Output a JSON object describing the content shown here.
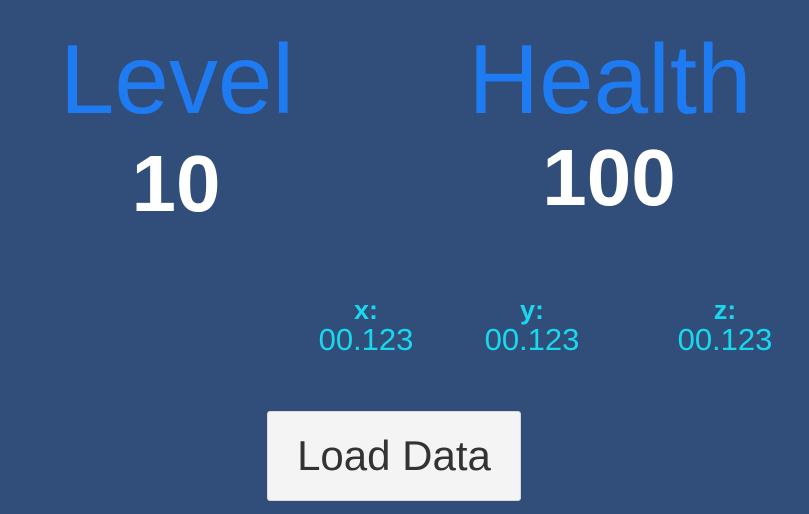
{
  "colors": {
    "background": "#314d7a",
    "stat_title": "#1e7bf2",
    "stat_value": "#ffffff",
    "coordinates": "#19d8ee",
    "button_background": "#f4f4f4",
    "button_text": "#333333"
  },
  "stats": {
    "level": {
      "title": "Level",
      "value": "10"
    },
    "health": {
      "title": "Health",
      "value": "100"
    }
  },
  "position": {
    "x": {
      "label": "x:",
      "value": "00.123"
    },
    "y": {
      "label": "y:",
      "value": "00.123"
    },
    "z": {
      "label": "z:",
      "value": "00.123"
    }
  },
  "actions": {
    "load_label": "Load Data"
  }
}
